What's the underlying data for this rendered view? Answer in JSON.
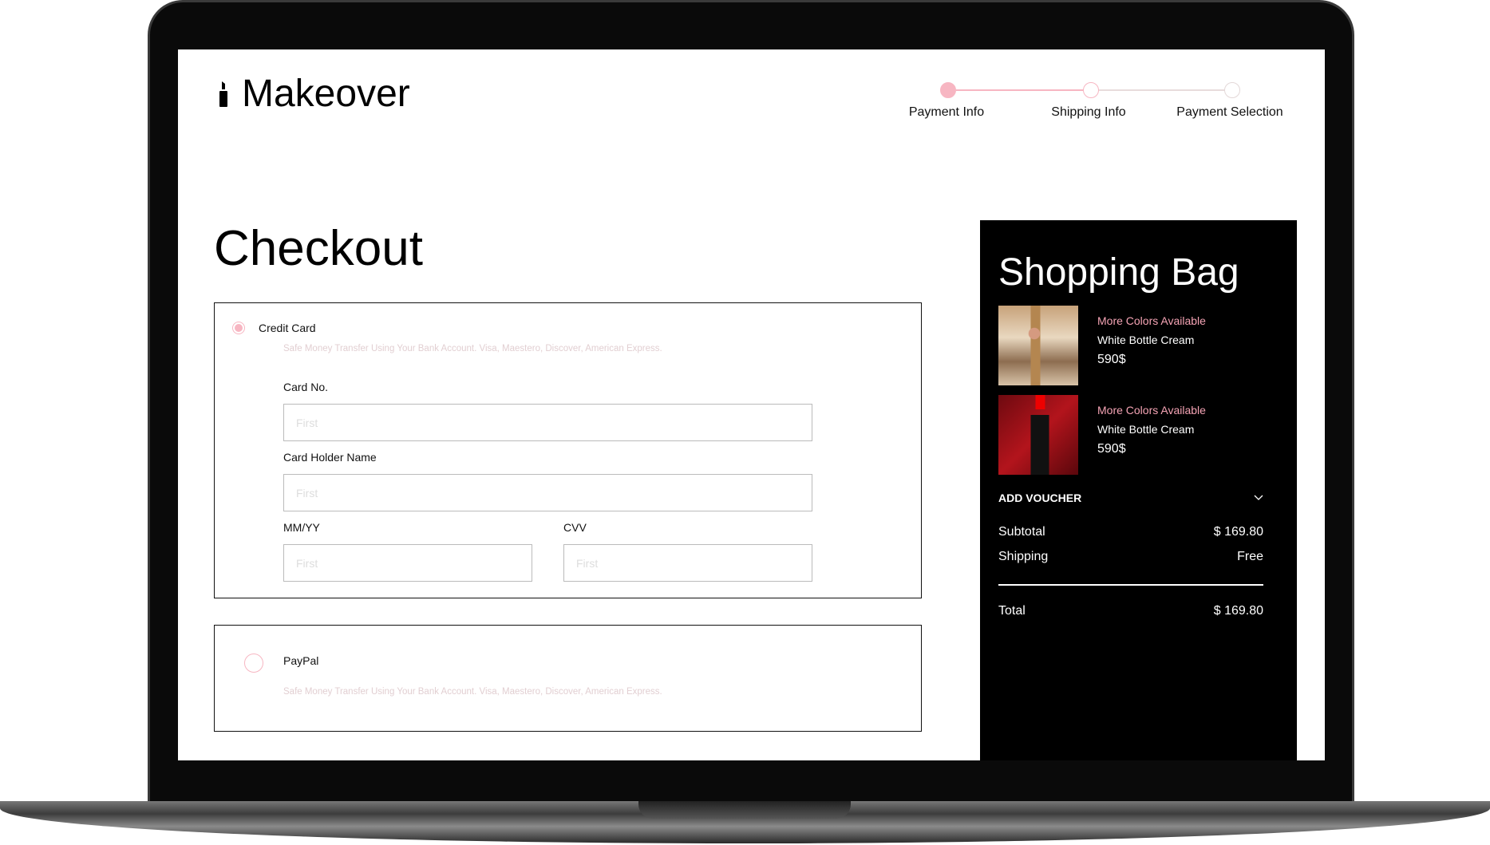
{
  "brand": {
    "name": "Makeover",
    "icon": "lipstick-icon"
  },
  "steps": [
    {
      "label": "Payment Info",
      "active": true
    },
    {
      "label": "Shipping Info",
      "active": false
    },
    {
      "label": "Payment Selection",
      "active": false
    }
  ],
  "page_title": "Checkout",
  "payment": {
    "credit_card": {
      "label": "Credit Card",
      "selected": true,
      "description": "Safe Money Transfer Using Your Bank Account. Visa, Maestero, Discover, American Express.",
      "card_no_label": "Card No.",
      "card_holder_label": "Card Holder Name",
      "expiry_label": "MM/YY",
      "cvv_label": "CVV",
      "placeholder": "First"
    },
    "paypal": {
      "label": "PayPal",
      "selected": false,
      "description": "Safe Money Transfer Using Your Bank Account. Visa, Maestero, Discover, American Express."
    }
  },
  "bag": {
    "title": "Shopping Bag",
    "items": [
      {
        "tag": "More Colors Available",
        "name": "White Bottle Cream",
        "price": "590$"
      },
      {
        "tag": "More Colors Available",
        "name": "White Bottle Cream",
        "price": "590$"
      }
    ],
    "voucher_label": "ADD VOUCHER",
    "subtotal_label": "Subtotal",
    "subtotal": "$ 169.80",
    "shipping_label": "Shipping",
    "shipping": "Free",
    "total_label": "Total",
    "total": "$ 169.80"
  },
  "colors": {
    "accent": "#f7b6c2",
    "tag": "#f4a3b4"
  }
}
